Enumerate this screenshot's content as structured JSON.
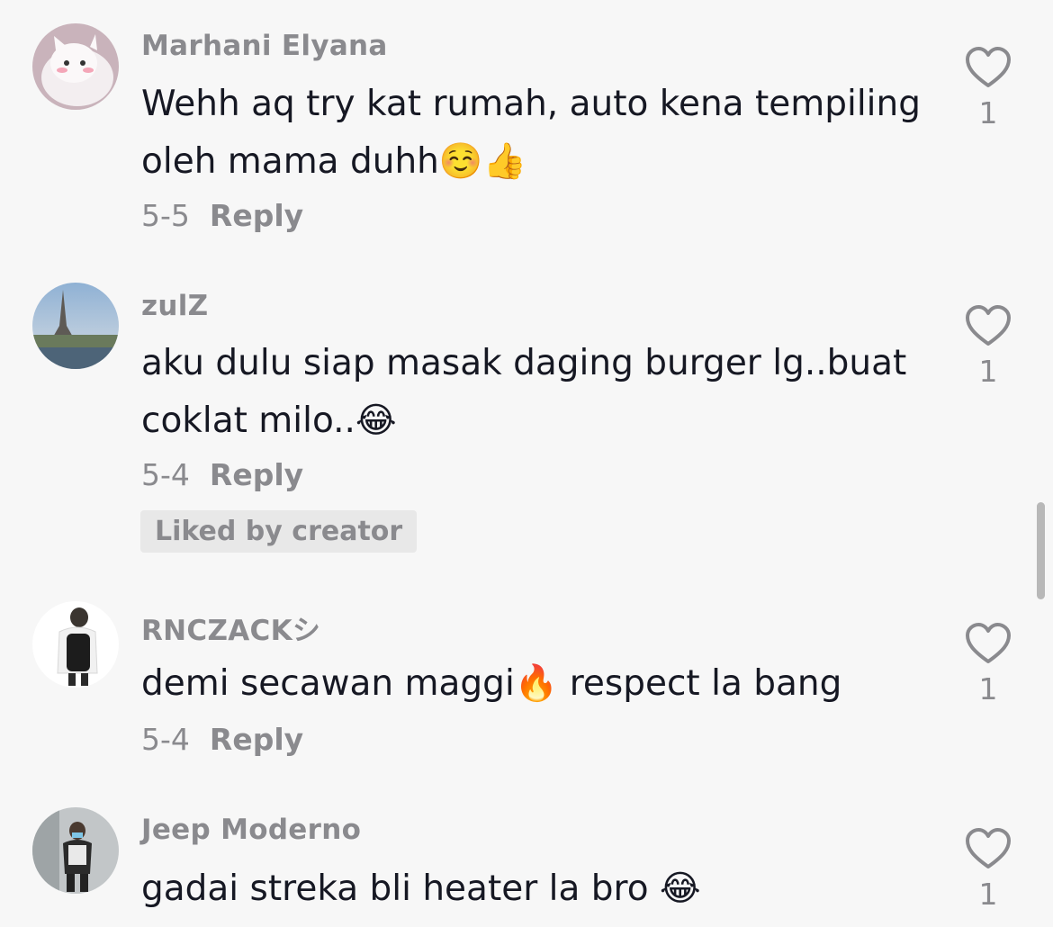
{
  "comments": [
    {
      "username": "Marhani Elyana",
      "text": "Wehh aq try kat rumah, auto kena tempiling oleh mama duhh☺️👍",
      "date": "5-5",
      "reply": "Reply",
      "likes": "1"
    },
    {
      "username": "zulZ",
      "text": "aku dulu siap masak daging burger lg..buat coklat milo..😂",
      "date": "5-4",
      "reply": "Reply",
      "badge": "Liked by creator",
      "likes": "1"
    },
    {
      "username": "RNCZACKシ",
      "text": "demi secawan maggi🔥 respect la bang",
      "date": "5-4",
      "reply": "Reply",
      "likes": "1"
    },
    {
      "username": "Jeep Moderno",
      "text": "gadai streka bli heater la bro 😂",
      "likes": "1"
    }
  ],
  "icons": {
    "like": "heart-outline-icon"
  },
  "colors": {
    "background": "#f7f7f7",
    "text": "#161823",
    "secondary": "#8a8a8e",
    "badge_bg": "#e8e8e8"
  }
}
